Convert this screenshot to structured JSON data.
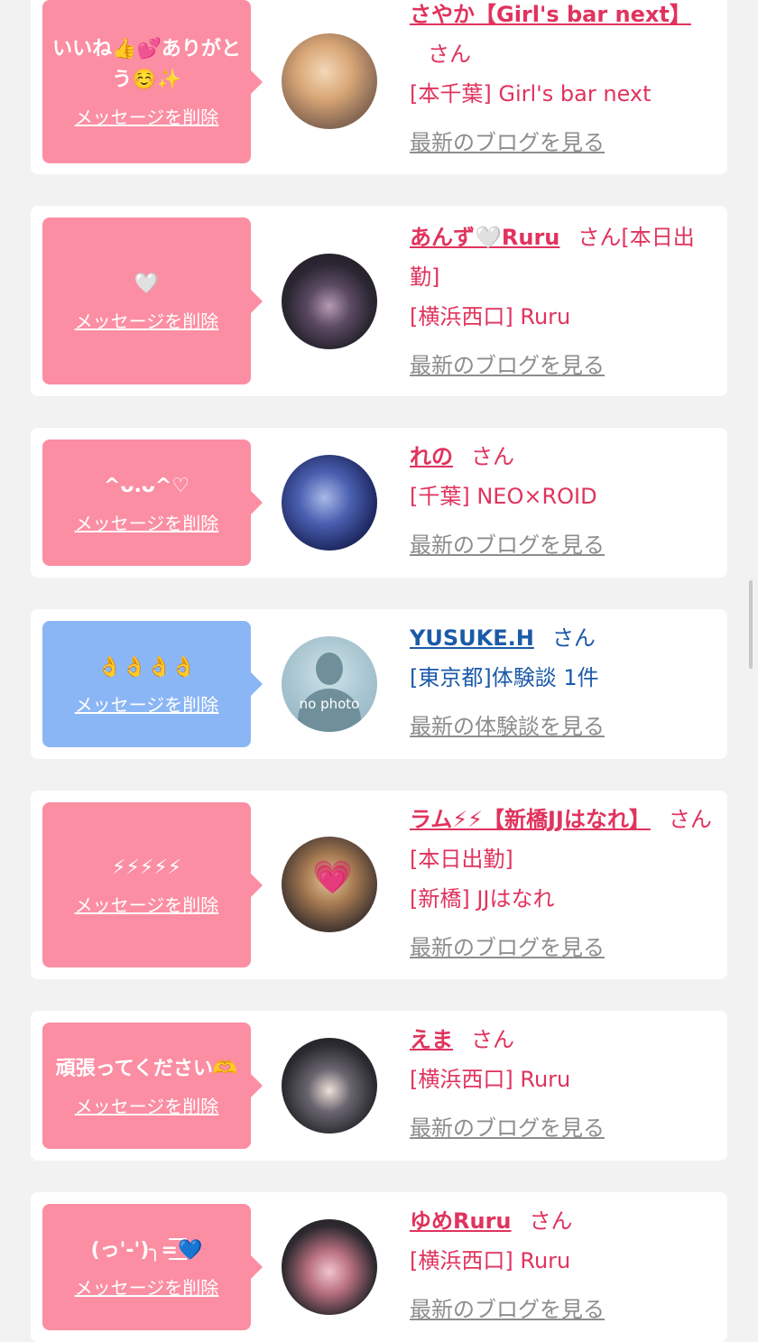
{
  "delete_label": "メッセージを削除",
  "colors": {
    "pink_bubble": "#fb8ea3",
    "blue_bubble": "#8bb6f5",
    "name_pink": "#e0335d",
    "name_blue": "#1c5aa8"
  },
  "items": [
    {
      "message": "いいね👍💕ありがとう☺️✨",
      "name": "さやか【Girl's bar next】",
      "suffix": "さん",
      "tag": "",
      "shop": "[本千葉] Girl's bar next",
      "link": "最新のブログを見る",
      "theme": "pink"
    },
    {
      "message": "🤍",
      "name": "あんず🤍Ruru",
      "suffix": "さん",
      "tag": "[本日出勤]",
      "shop": "[横浜西口] Ruru",
      "link": "最新のブログを見る",
      "theme": "pink"
    },
    {
      "message": "^ᴗ.ᴗ^♡",
      "name": "れの",
      "suffix": "さん",
      "tag": "",
      "shop": "[千葉] NEO×ROID",
      "link": "最新のブログを見る",
      "theme": "pink"
    },
    {
      "message": "👌👌👌👌",
      "name": "YUSUKE.H",
      "suffix": "さん",
      "tag": "",
      "shop": "[東京都]体験談 1件",
      "link": "最新の体験談を見る",
      "theme": "blue",
      "avatar_text": "no photo"
    },
    {
      "message": "⚡⚡⚡⚡⚡",
      "name": "ラム⚡⚡【新橋JJはなれ】",
      "suffix": "さん",
      "tag": "[本日出勤]",
      "shop": "[新橋] JJはなれ",
      "link": "最新のブログを見る",
      "theme": "pink"
    },
    {
      "message": "頑張ってください🫶",
      "name": "えま",
      "suffix": "さん",
      "tag": "",
      "shop": "[横浜西口] Ruru",
      "link": "最新のブログを見る",
      "theme": "pink"
    },
    {
      "message": "(っ'-')╮=͟͟͞͞💙",
      "name": "ゆめRuru",
      "suffix": "さん",
      "tag": "",
      "shop": "[横浜西口] Ruru",
      "link": "最新のブログを見る",
      "theme": "pink"
    }
  ]
}
